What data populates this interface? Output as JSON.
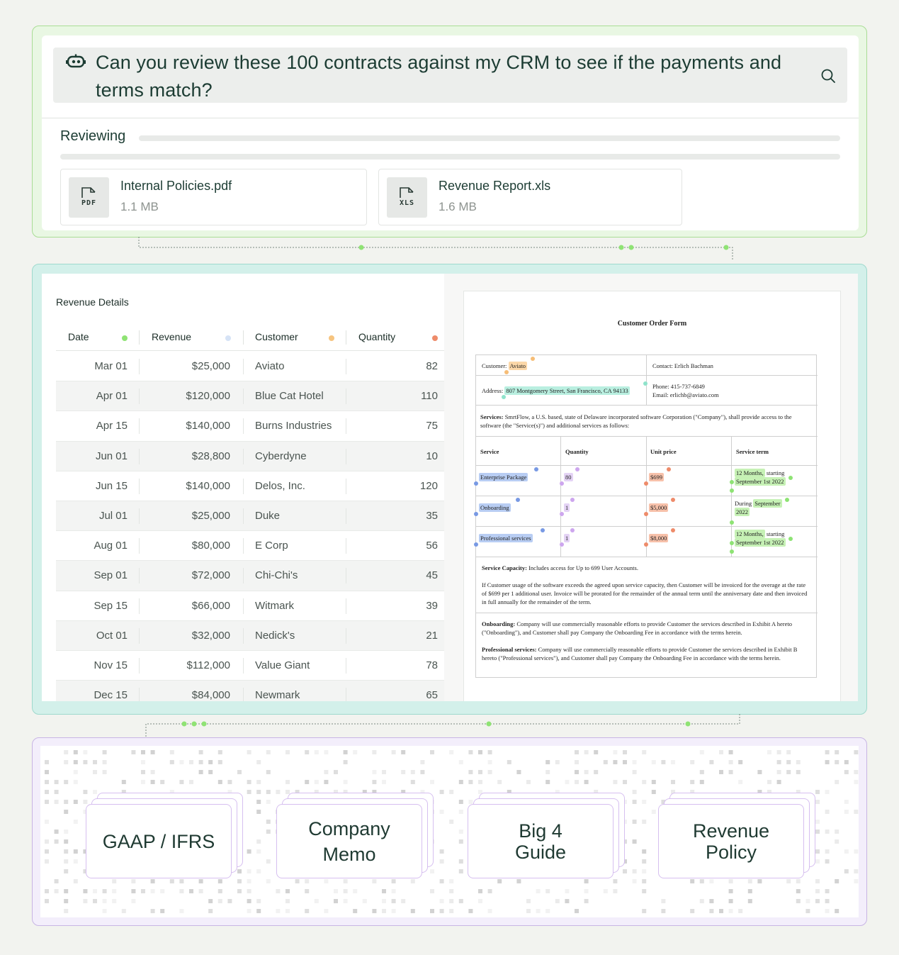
{
  "query": {
    "text": "Can you review these 100 contracts against my CRM to see if the payments and terms match?"
  },
  "status": {
    "label": "Reviewing"
  },
  "files": [
    {
      "name": "Internal Policies.pdf",
      "size": "1.1 MB",
      "type_label": "PDF"
    },
    {
      "name": "Revenue Report.xls",
      "size": "1.6 MB",
      "type_label": "XLS"
    }
  ],
  "revenue": {
    "title": "Revenue Details",
    "columns": [
      "Date",
      "Revenue",
      "Customer",
      "Quantity"
    ],
    "column_colors": [
      "#8fe374",
      "#d6e3f6",
      "#f6c47f",
      "#ee8b6a"
    ],
    "rows": [
      [
        "Mar 01",
        "$25,000",
        "Aviato",
        "82"
      ],
      [
        "Apr 01",
        "$120,000",
        "Blue Cat Hotel",
        "110"
      ],
      [
        "Apr 15",
        "$140,000",
        "Burns Industries",
        "75"
      ],
      [
        "Jun 01",
        "$28,800",
        "Cyberdyne",
        "10"
      ],
      [
        "Jun 15",
        "$140,000",
        "Delos, Inc.",
        "120"
      ],
      [
        "Jul 01",
        "$25,000",
        "Duke",
        "35"
      ],
      [
        "Aug 01",
        "$80,000",
        "E Corp",
        "56"
      ],
      [
        "Sep 01",
        "$72,000",
        "Chi-Chi's",
        "45"
      ],
      [
        "Sep 15",
        "$66,000",
        "Witmark",
        "39"
      ],
      [
        "Oct 01",
        "$32,000",
        "Nedick's",
        "21"
      ],
      [
        "Nov 15",
        "$112,000",
        "Value Giant",
        "78"
      ],
      [
        "Dec 15",
        "$84,000",
        "Newmark",
        "65"
      ]
    ]
  },
  "order_form": {
    "title": "Customer Order Form",
    "customer_label": "Customer:",
    "customer": "Aviato",
    "contact": "Contact: Erlich Bachman",
    "address_label": "Address:",
    "address": "807 Montgomery Street, San Francisco, CA 94133",
    "phone": "Phone: 415-737-6849",
    "email": "Email: erlichb@aviato.com",
    "services_label": "Services:",
    "services_text": "SmrtFlow, a U.S. based, state of Delaware incorporated software Corporation (\"Company\"), shall provide access to the software (the \"Service(s)\") and additional services as follows:",
    "service_headers": [
      "Service",
      "Quantity",
      "Unit price",
      "Service term"
    ],
    "services": [
      {
        "name": "Enterprise Package",
        "qty": "80",
        "price": "$699",
        "term_pre": "",
        "term_hl1": "12 Months,",
        "term_mid": " starting",
        "term_hl2": "September 1st 2022"
      },
      {
        "name": "Onboarding",
        "qty": "1",
        "price": "$5,000",
        "term_pre": "During ",
        "term_hl1": "September",
        "term_mid": "",
        "term_hl2": "2022"
      },
      {
        "name": "Professional services",
        "qty": "1",
        "price": "$8,000",
        "term_pre": "",
        "term_hl1": "12 Months,",
        "term_mid": " starting",
        "term_hl2": "September 1st 2022"
      }
    ],
    "capacity_label": "Service Capacity:",
    "capacity_text": "Includes access for Up to 699 User Accounts.",
    "overage_text": "If Customer usage of the software exceeds the agreed upon service capacity, then Customer will be invoiced for the overage at the rate of $699 per 1 additional user. Invoice will be prorated for the remainder of the annual term until the anniversary date and then invoiced in full annually for the remainder of the term.",
    "onboarding_label": "Onboarding:",
    "onboarding_text": "Company will use commercially reasonable efforts to provide Customer the services described in Exhibit A hereto (\"Onboarding\"), and Customer shall pay Company the Onboarding Fee in accordance with the terms herein.",
    "prof_label": "Professional services:",
    "prof_text": "Company will use commercially reasonable efforts to provide Customer the services described in Exhibit B hereto (\"Professional services\"), and Customer shall pay Company the Onboarding Fee in accordance with the terms herein."
  },
  "knowledge": [
    {
      "label": "GAAP / IFRS"
    },
    {
      "label": "Company Memo"
    },
    {
      "label": "Big 4 Guide"
    },
    {
      "label": "Revenue Policy"
    }
  ],
  "colors": {
    "query_panel_border": "#a9dd95",
    "revenue_panel_bg": "#d3f0ea",
    "knowledge_panel_border": "#c8b5e4",
    "connector_dot": "#8fe374"
  }
}
